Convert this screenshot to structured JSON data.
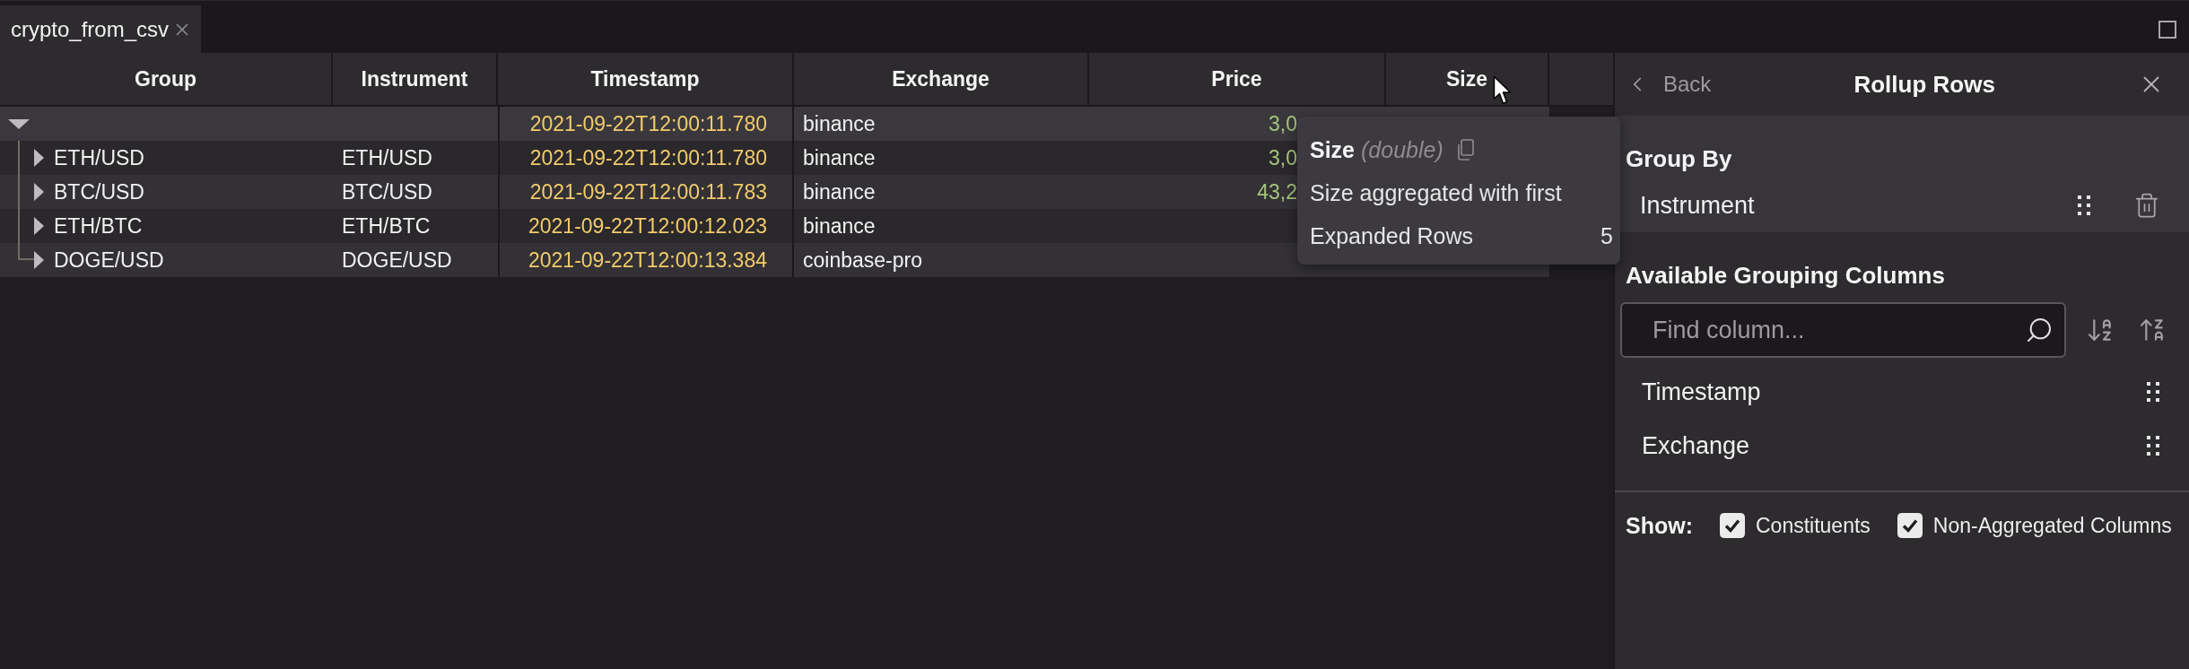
{
  "tabs": [
    {
      "label": "crypto_from_csv",
      "selected": true
    }
  ],
  "table": {
    "columns": [
      {
        "label": "Group",
        "kind": "tree"
      },
      {
        "label": "Instrument",
        "kind": "text"
      },
      {
        "label": "Timestamp",
        "kind": "date"
      },
      {
        "label": "Exchange",
        "kind": "text"
      },
      {
        "label": "Price",
        "kind": "number"
      },
      {
        "label": "Size",
        "kind": "number"
      }
    ],
    "rows": [
      {
        "expanded": true,
        "timestamp": "2021-09-22T12:00:11.780",
        "exchange": "binance",
        "price": "3,0",
        "children": [
          {
            "expanded": false,
            "group": "ETH/USD",
            "instrument": "ETH/USD",
            "timestamp": "2021-09-22T12:00:11.780",
            "exchange": "binance",
            "price": "3,0"
          },
          {
            "expanded": false,
            "group": "BTC/USD",
            "instrument": "BTC/USD",
            "timestamp": "2021-09-22T12:00:11.783",
            "exchange": "binance",
            "price": "43,2"
          },
          {
            "expanded": false,
            "group": "ETH/BTC",
            "instrument": "ETH/BTC",
            "timestamp": "2021-09-22T12:00:12.023",
            "exchange": "binance"
          },
          {
            "expanded": false,
            "group": "DOGE/USD",
            "instrument": "DOGE/USD",
            "timestamp": "2021-09-22T12:00:13.384",
            "exchange": "coinbase-pro"
          }
        ]
      }
    ]
  },
  "tooltip": {
    "title": "Size",
    "type": "(double)",
    "description": "Size aggregated with first",
    "stats": [
      {
        "label": "Expanded Rows",
        "value": "5"
      }
    ]
  },
  "panel": {
    "back": "Back",
    "title": "Rollup Rows",
    "group_by": {
      "heading": "Group By",
      "items": [
        "Instrument"
      ]
    },
    "available": {
      "heading": "Available Grouping Columns",
      "search": {
        "placeholder": "Find column..."
      },
      "items": [
        "Timestamp",
        "Exchange"
      ]
    },
    "show": {
      "label": "Show:",
      "options": [
        {
          "label": "Constituents",
          "checked": true
        },
        {
          "label": "Non-Aggregated Columns",
          "checked": true
        }
      ]
    }
  }
}
